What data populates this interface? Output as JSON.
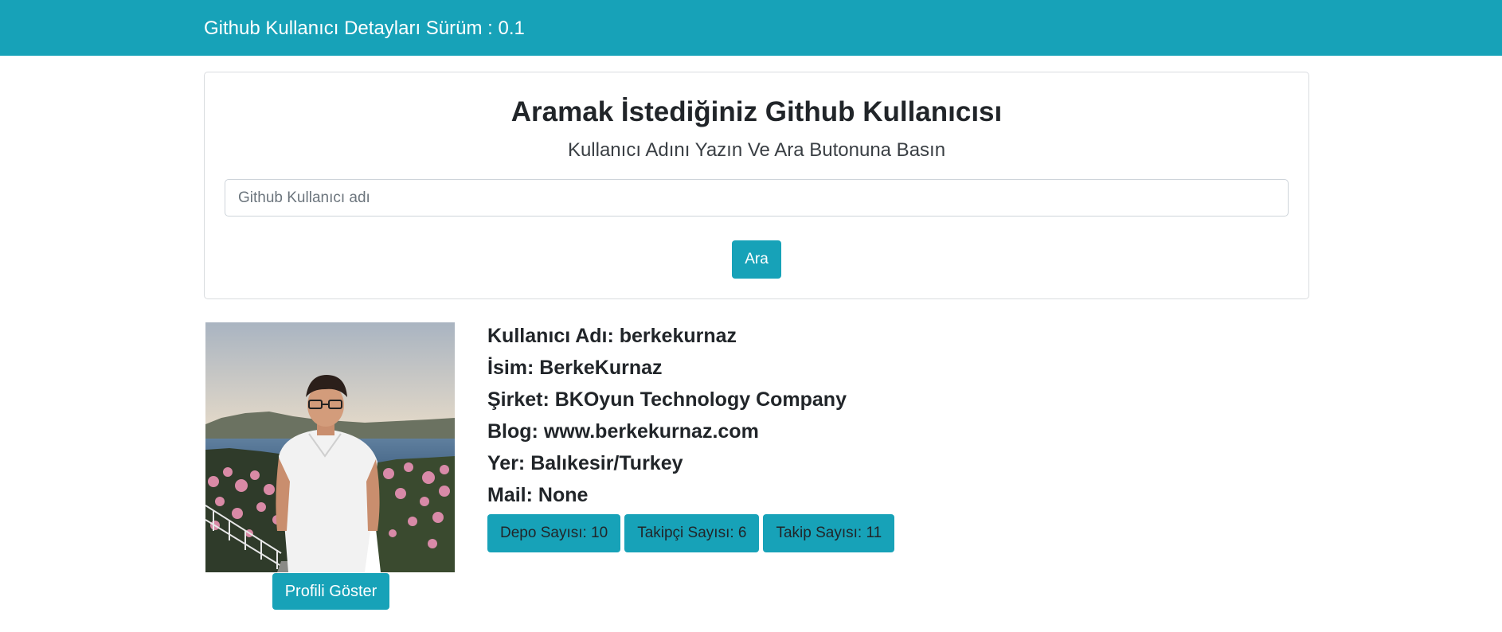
{
  "navbar": {
    "title": "Github Kullanıcı Detayları Sürüm : 0.1"
  },
  "search": {
    "title": "Aramak İstediğiniz Github Kullanıcısı",
    "subtitle": "Kullanıcı Adını Yazın Ve Ara Butonuna Basın",
    "input_placeholder": "Github Kullanıcı adı",
    "input_value": "",
    "button_label": "Ara"
  },
  "profile": {
    "button_label": "Profili Göster",
    "details": [
      {
        "label": "Kullanıcı Adı: berkekurnaz"
      },
      {
        "label": "İsim: BerkeKurnaz"
      },
      {
        "label": "Şirket: BKOyun Technology Company"
      },
      {
        "label": "Blog: www.berkekurnaz.com"
      },
      {
        "label": "Yer: Balıkesir/Turkey"
      },
      {
        "label": "Mail: None"
      }
    ],
    "badges": [
      {
        "label": "Depo Sayısı: 10"
      },
      {
        "label": "Takipçi Sayısı: 6"
      },
      {
        "label": "Takip Sayısı: 11"
      }
    ]
  },
  "colors": {
    "accent": "#17a2b8",
    "text": "#212529",
    "border": "#d9dcdf"
  }
}
